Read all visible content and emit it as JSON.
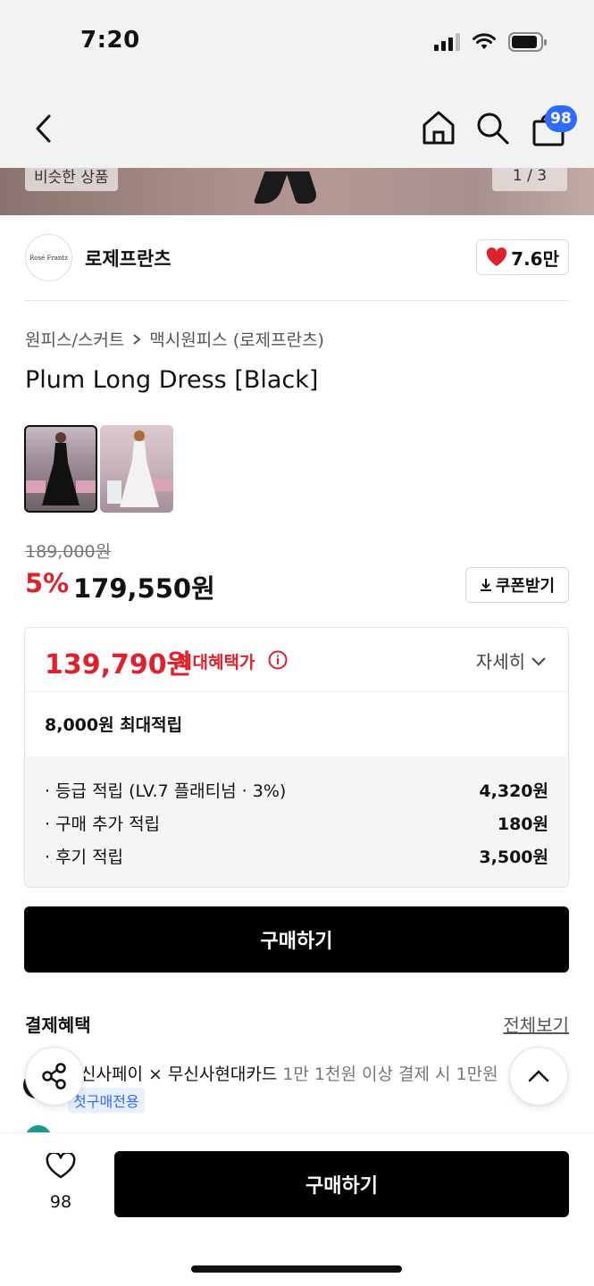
{
  "status_bar": {
    "time": "7:20"
  },
  "nav": {
    "cart_count": "98"
  },
  "hero": {
    "similar_label": "비슷한 상품",
    "page_indicator": "1 / 3"
  },
  "brand": {
    "logo_text": "Rosé Frantz",
    "name": "로제프란츠",
    "likes": "7.6만"
  },
  "breadcrumb": {
    "category": "원피스/스커트",
    "subcategory": "맥시원피스 (로제프란츠)"
  },
  "product": {
    "title": "Plum Long Dress [Black]"
  },
  "price": {
    "original": "189,000원",
    "discount": "5%",
    "sale": "179,550원",
    "coupon_label": "쿠폰받기"
  },
  "benefit": {
    "max_price": "139,790원",
    "max_label": "최대혜택가",
    "detail_label": "자세히",
    "points_total": "8,000원 최대적립",
    "points": [
      {
        "label": "· 등급 적립 (LV.7 플래티넘 · 3%)",
        "value": "4,320원"
      },
      {
        "label": "· 구매 추가 적립",
        "value": "180원"
      },
      {
        "label": "· 후기 적립",
        "value": "3,500원"
      }
    ]
  },
  "buy_button": "구매하기",
  "payment": {
    "title": "결제혜택",
    "see_all": "전체보기",
    "line1_main": "신사페이 × 무신사현대카드",
    "line1_detail": " 1만 1천원 이상 결제 시 1만원",
    "first_badge": "첫구매전용"
  },
  "bottom": {
    "like_count": "98",
    "buy_label": "구매하기"
  },
  "colors": {
    "accent_red": "#e0202c",
    "badge_blue": "#2f6bff",
    "primary_black": "#000000"
  }
}
